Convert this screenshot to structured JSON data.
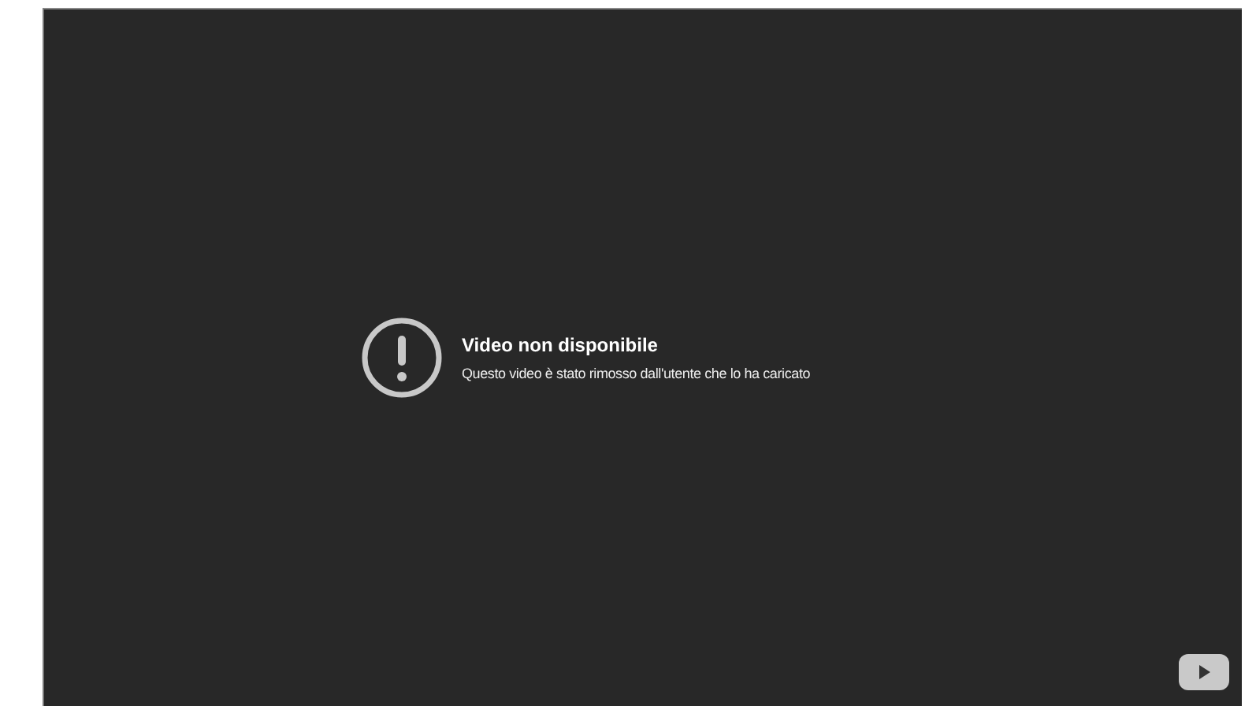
{
  "player": {
    "error": {
      "title": "Video non disponibile",
      "message": "Questo video è stato rimosso dall'utente che lo ha caricato"
    }
  }
}
